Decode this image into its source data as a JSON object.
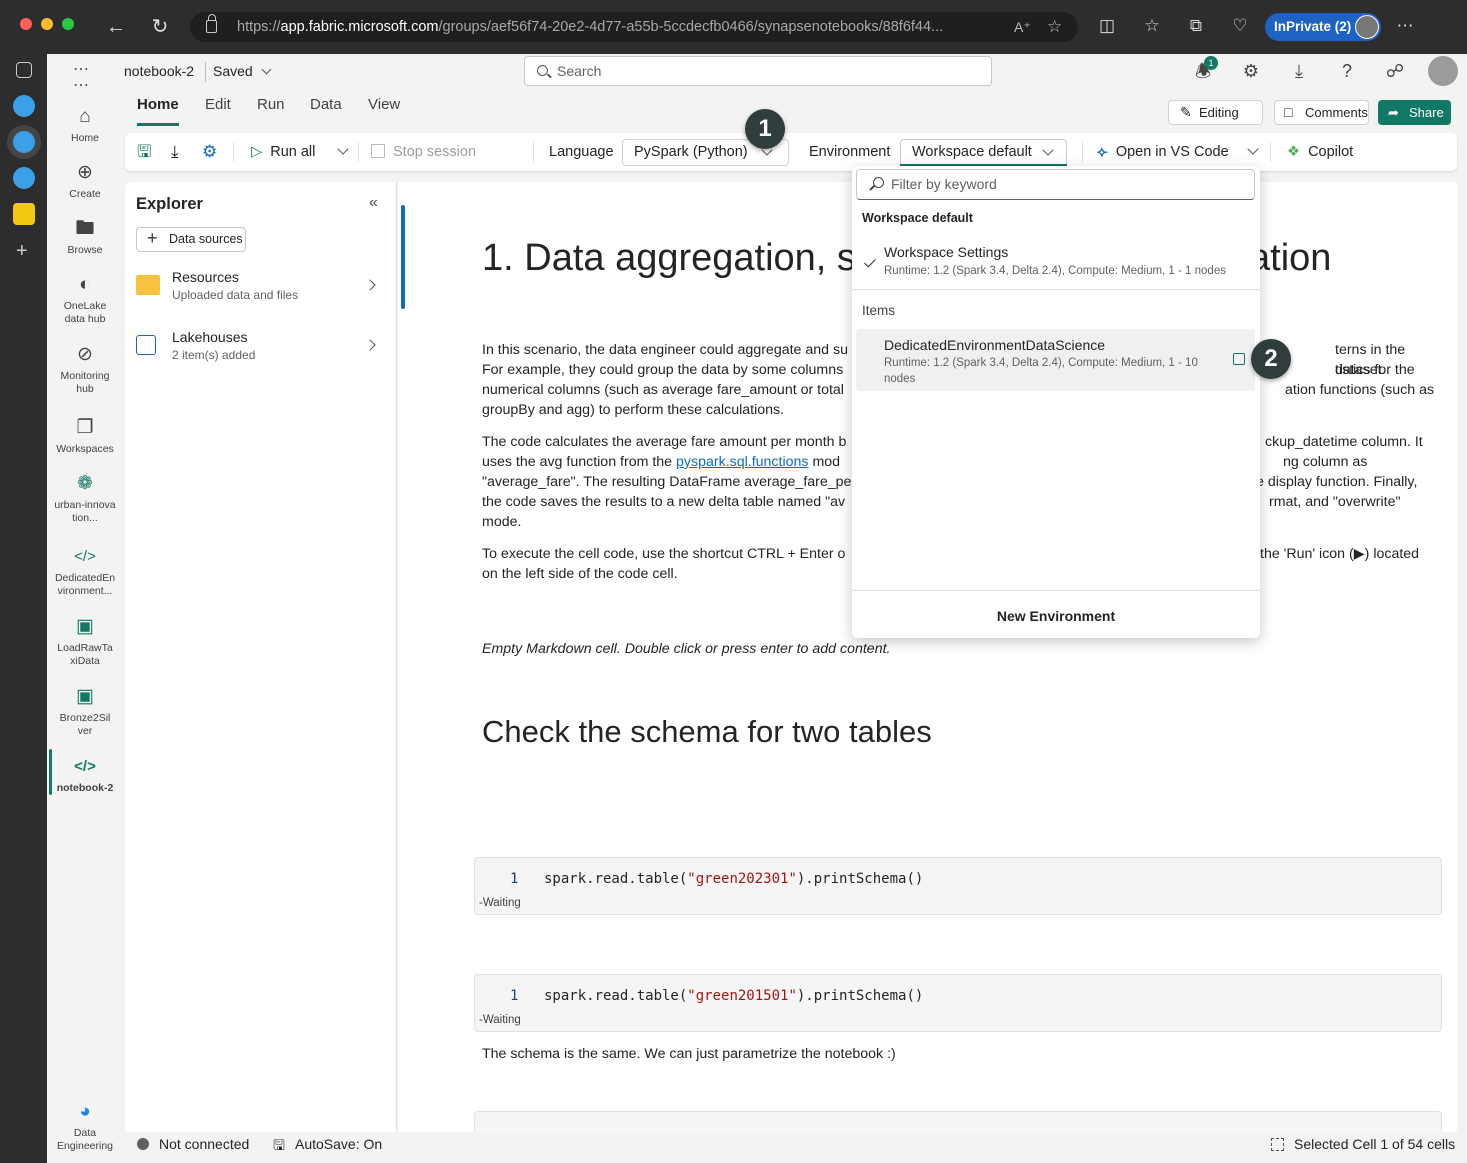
{
  "browser": {
    "url_prefix": "https://",
    "url_domain": "app.fabric.microsoft.com",
    "url_path": "/groups/aef56f74-20e2-4d77-a55b-5ccdecfb0466/synapsenotebooks/88f6f44...",
    "inprivate_label": "InPrivate (2)"
  },
  "app": {
    "notebook_name": "notebook-2",
    "save_status": "Saved",
    "search_placeholder": "Search",
    "notification_count": "1"
  },
  "appbar": {
    "items": [
      {
        "label": "Home",
        "icon": "home-icon"
      },
      {
        "label": "Create",
        "icon": "create-icon"
      },
      {
        "label": "Browse",
        "icon": "browse-icon"
      },
      {
        "label": "OneLake data hub",
        "icon": "onelake-icon"
      },
      {
        "label": "Monitoring hub",
        "icon": "monitoring-icon"
      },
      {
        "label": "Workspaces",
        "icon": "workspaces-icon"
      },
      {
        "label": "urban-innovation...",
        "icon": "workspace-icon"
      },
      {
        "label": "DedicatedEnvironment...",
        "icon": "environment-icon"
      },
      {
        "label": "LoadRawTaxiData",
        "icon": "notebook-icon"
      },
      {
        "label": "Bronze2Silver",
        "icon": "notebook-icon"
      },
      {
        "label": "notebook-2",
        "icon": "notebook-icon"
      }
    ],
    "experience_label": "Data Engineering"
  },
  "ribbon": {
    "tabs": [
      "Home",
      "Edit",
      "Run",
      "Data",
      "View"
    ],
    "active_tab": "Home",
    "editing_label": "Editing",
    "comments_label": "Comments",
    "share_label": "Share"
  },
  "toolbar": {
    "run_all": "Run all",
    "stop_session": "Stop session",
    "language_label": "Language",
    "language_value": "PySpark (Python)",
    "environment_label": "Environment",
    "environment_value": "Workspace default",
    "open_vscode": "Open in VS Code",
    "copilot": "Copilot"
  },
  "callouts": {
    "one": "1",
    "two": "2"
  },
  "explorer": {
    "title": "Explorer",
    "data_sources_button": "Data sources",
    "items": [
      {
        "title": "Resources",
        "subtitle": "Uploaded data and files"
      },
      {
        "title": "Lakehouses",
        "subtitle": "2 item(s) added"
      }
    ]
  },
  "notebook": {
    "heading1": "1. Data aggregation, su",
    "heading1_tail": "ation",
    "para1_left": "In this scenario, the data engineer could aggregate and su",
    "para1_right": "terns in the dataset.",
    "para1_l2": "For example, they could group the data by some columns",
    "para1_r2": "tistics for the",
    "para1_l3": "numerical columns (such as average fare_amount or total",
    "para1_r3": "ation functions (such as",
    "para1_l4": "groupBy and agg) to perform these calculations.",
    "para2_l1": "The code calculates the average fare amount per month b",
    "para2_r1": "ckup_datetime column. It",
    "para2_l2a": "uses the avg function from the ",
    "para2_link": "pyspark.sql.functions",
    "para2_l2b": " mod",
    "para2_r2": "ng column as",
    "para2_l3": "\"average_fare\". The resulting DataFrame average_fare_pe",
    "para2_r3": "e display function. Finally,",
    "para2_l4": "the code saves the results to a new delta table named \"av",
    "para2_r4": "rmat, and \"overwrite\"",
    "para2_l5": "mode.",
    "para3_l1": "To execute the cell code, use the shortcut CTRL + Enter o",
    "para3_r1": " the 'Run' icon (▶) located",
    "para3_l2": "on the left side of the code cell.",
    "empty_markdown": "Empty Markdown cell. Double click or press enter to add content.",
    "heading2": "Check the schema for two tables",
    "cells": [
      {
        "line": "1",
        "code_a": "spark.read.table(",
        "code_str": "\"green202301\"",
        "code_b": ").printSchema()",
        "status": "-Waiting"
      },
      {
        "line": "1",
        "code_a": "spark.read.table(",
        "code_str": "\"green201501\"",
        "code_b": ").printSchema()",
        "status": "-Waiting"
      }
    ],
    "schema_note": "The schema is the same. We can just parametrize the notebook :)"
  },
  "environment_dropdown": {
    "filter_placeholder": "Filter by keyword",
    "section_default": "Workspace default",
    "default_item_name": "Workspace Settings",
    "default_item_desc": "Runtime: 1.2 (Spark 3.4, Delta 2.4), Compute: Medium, 1 - 1 nodes",
    "section_items": "Items",
    "item_name": "DedicatedEnvironmentDataScience",
    "item_desc": "Runtime: 1.2 (Spark 3.4, Delta 2.4), Compute: Medium, 1 - 10 nodes",
    "new_env": "New Environment"
  },
  "status": {
    "connection": "Not connected",
    "autosave": "AutoSave: On",
    "selection": "Selected Cell 1 of 54 cells"
  },
  "colors": {
    "accent": "#117865",
    "link": "#0f6cbd",
    "inprivate": "#1e63c4"
  }
}
